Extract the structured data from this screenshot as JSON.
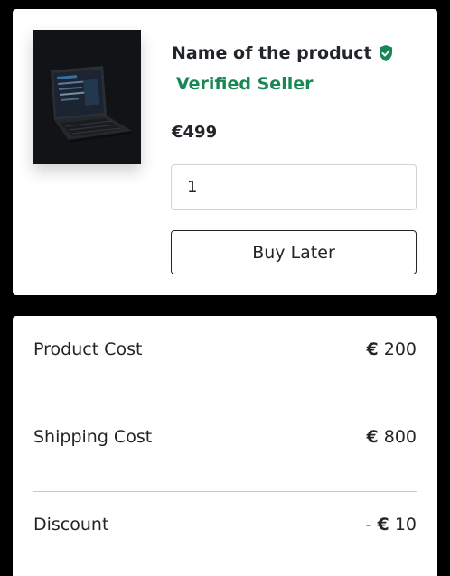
{
  "product": {
    "name": "Name of the product",
    "seller_badge": "Verified Seller",
    "price": "€499",
    "quantity": "1",
    "buy_later_label": "Buy Later",
    "verified_icon": "shield-check-icon",
    "image": "laptop-image"
  },
  "summary": {
    "rows": [
      {
        "label": "Product Cost",
        "prefix": "",
        "currency": "€",
        "amount": "200"
      },
      {
        "label": "Shipping Cost",
        "prefix": "",
        "currency": "€",
        "amount": "800"
      },
      {
        "label": "Discount",
        "prefix": "- ",
        "currency": "€",
        "amount": "10"
      }
    ]
  },
  "colors": {
    "background": "#000000",
    "card": "#ffffff",
    "verified_green": "#198754",
    "text": "#212529"
  }
}
